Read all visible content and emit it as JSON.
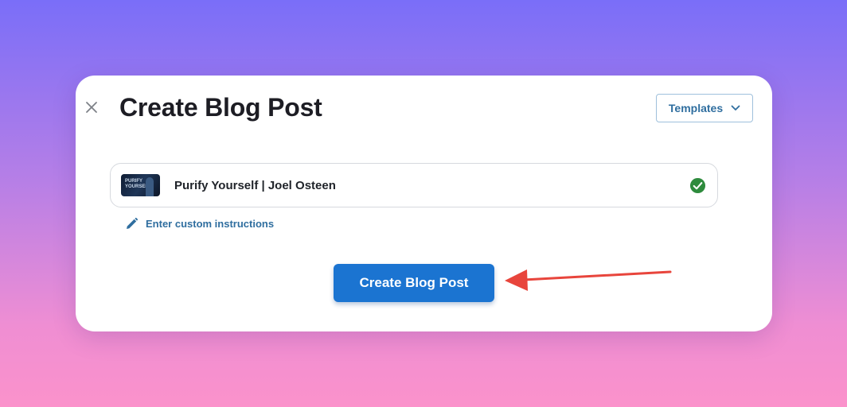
{
  "modal": {
    "title": "Create Blog Post",
    "templates_label": "Templates",
    "video": {
      "thumbnail_text": "PURIFY YOURSELF",
      "title": "Purify Yourself | Joel Osteen"
    },
    "custom_instructions_label": "Enter custom instructions",
    "create_button_label": "Create Blog Post"
  },
  "colors": {
    "primary_button": "#1b74d1",
    "link": "#2f6e9f",
    "success_check": "#2e8b3d",
    "annotation_arrow": "#e8453c"
  },
  "icons": {
    "close": "close-icon",
    "templates_dropdown": "chevron-down-icon",
    "verified": "check-circle-icon",
    "edit": "pencil-icon"
  }
}
